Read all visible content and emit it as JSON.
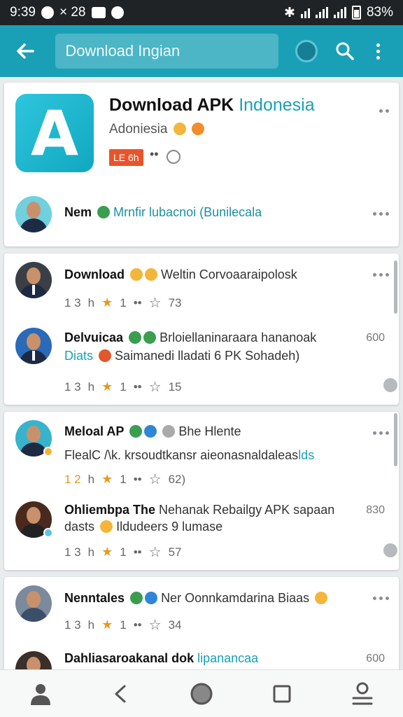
{
  "status_bar": {
    "time": "9:39",
    "extra": "× 28",
    "battery": "83%"
  },
  "app_bar": {
    "search_text": "Download Ingian"
  },
  "app_card": {
    "title_main": "Download APK",
    "title_accent": "Indonesia",
    "subtitle": "Adoniesia",
    "badge": "LE 6h",
    "meta": "••",
    "news_name": "Nem",
    "news_text": "Mrnfir lubacnoi (Bunilecala"
  },
  "posts": [
    {
      "name": "Download",
      "text": "Weltin Corvoaaraipolosk",
      "stats": {
        "a": "1 3",
        "b": "h",
        "c": "1",
        "d": "••",
        "e": "73"
      }
    },
    {
      "name": "Delvuicaa",
      "text": "Brloiellaninaraara hananoak",
      "count": "600",
      "line2_prefix": "Diats",
      "line2_text": "Saimanedi lladati",
      "line2_tail": "6 PK Sohadeh)",
      "stats": {
        "a": "1 3",
        "b": "h",
        "c": "1",
        "d": "••",
        "e": "15"
      }
    },
    {
      "name": "Meloal AP",
      "text": "Bhe Hlente",
      "line2_text": "FlealC /\\k. krsoudtkansr aieonasnaldaleas",
      "line2_hl": "lds",
      "stats": {
        "a": "1 2",
        "b": "h",
        "c": "1",
        "d": "••",
        "e": "62)"
      }
    },
    {
      "name": "Ohliembpa The",
      "text": "Nehanak Rebailgy APK sapaan",
      "count": "830",
      "line2_prefix": "dasts",
      "line2_text": "Ildudeers 9 lumase",
      "stats": {
        "a": "1 3",
        "b": "h",
        "c": "1",
        "d": "••",
        "e": "57"
      }
    },
    {
      "name": "Nenntales",
      "text": "Ner Oonnkamdarina Biaas",
      "stats": {
        "a": "1 3",
        "b": "h",
        "c": "1",
        "d": "••",
        "e": "34"
      }
    },
    {
      "name": "Dahliasaroakanal dok",
      "hl": "lipanancaa",
      "count": "600"
    }
  ],
  "icons": {
    "back": "arrow-left",
    "search": "search",
    "overflow": "more-vert",
    "home": "person-home",
    "nav_back": "chevron-left",
    "nav_home": "circle",
    "nav_recent": "square",
    "profile": "person"
  },
  "colors": {
    "app_bar": "#1aa0b6",
    "accent": "#1aa0b6",
    "badge": "#e8542a",
    "star": "#e69a1a"
  }
}
